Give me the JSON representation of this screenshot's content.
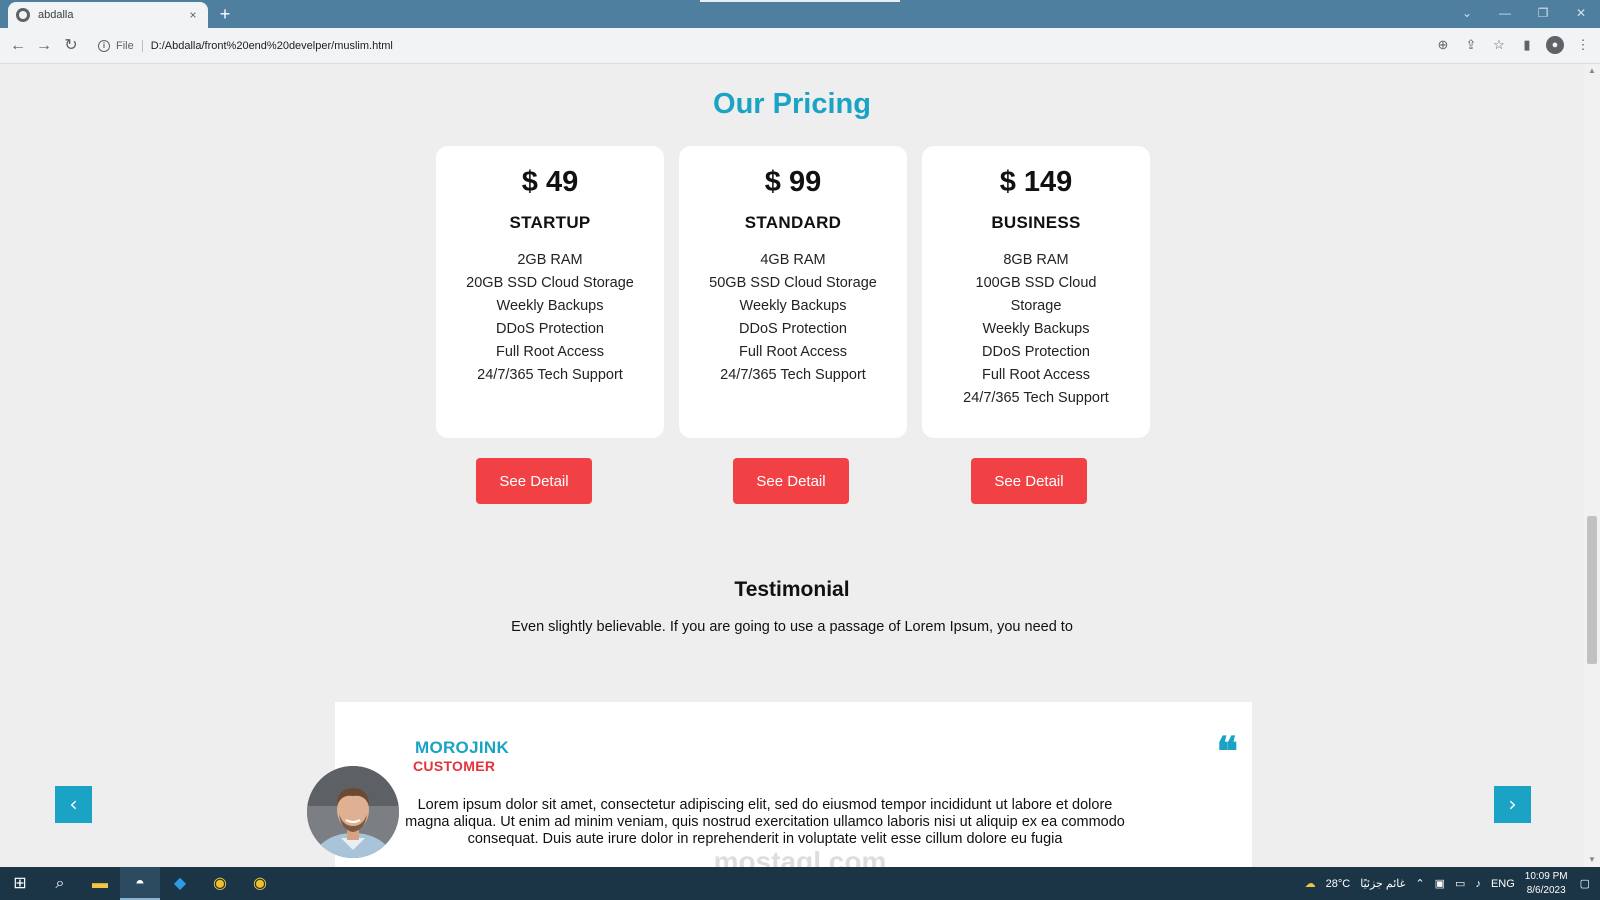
{
  "browser": {
    "tab_title": "abdalla",
    "tab_close": "×",
    "new_tab": "+",
    "file_label": "File",
    "url": "D:/Abdalla/front%20end%20develper/muslim.html"
  },
  "pricing": {
    "title": "Our Pricing",
    "plans": [
      {
        "price": "$ 49",
        "name": "STARTUP",
        "features": [
          "2GB RAM",
          "20GB SSD Cloud Storage",
          "Weekly Backups",
          "DDoS Protection",
          "Full Root Access",
          "24/7/365 Tech Support"
        ],
        "button": "See Detail"
      },
      {
        "price": "$ 99",
        "name": "STANDARD",
        "features": [
          "4GB RAM",
          "50GB SSD Cloud Storage",
          "Weekly Backups",
          "DDoS Protection",
          "Full Root Access",
          "24/7/365 Tech Support"
        ],
        "button": "See Detail"
      },
      {
        "price": "$ 149",
        "name": "BUSINESS",
        "features": [
          "8GB RAM",
          "100GB SSD Cloud Storage",
          "Weekly Backups",
          "DDoS Protection",
          "Full Root Access",
          "24/7/365 Tech Support"
        ],
        "button": "See Detail"
      }
    ]
  },
  "testimonial": {
    "title": "Testimonial",
    "subtitle": "Even slightly believable. If you are going to use a passage of Lorem Ipsum, you need to",
    "name": "MOROJINK",
    "role": "CUSTOMER",
    "quote_mark": "❝",
    "text": "Lorem ipsum dolor sit amet, consectetur adipiscing elit, sed do eiusmod tempor incididunt ut labore et dolore magna aliqua. Ut enim ad minim veniam, quis nostrud exercitation ullamco laboris nisi ut aliquip ex ea commodo consequat. Duis aute irure dolor in reprehenderit in voluptate velit esse cillum dolore eu fugia",
    "prev_arrow": "‹",
    "next_arrow": "›"
  },
  "watermark": "mostaql.com",
  "taskbar": {
    "weather": "28°C",
    "weather_text": "غائم جزئيًا",
    "language": "ENG",
    "time": "10:09 PM",
    "date": "8/6/2023"
  },
  "colors": {
    "accent": "#1aa3c4",
    "button": "#f24144",
    "role": "#e3333a",
    "background": "#eeeeee"
  }
}
